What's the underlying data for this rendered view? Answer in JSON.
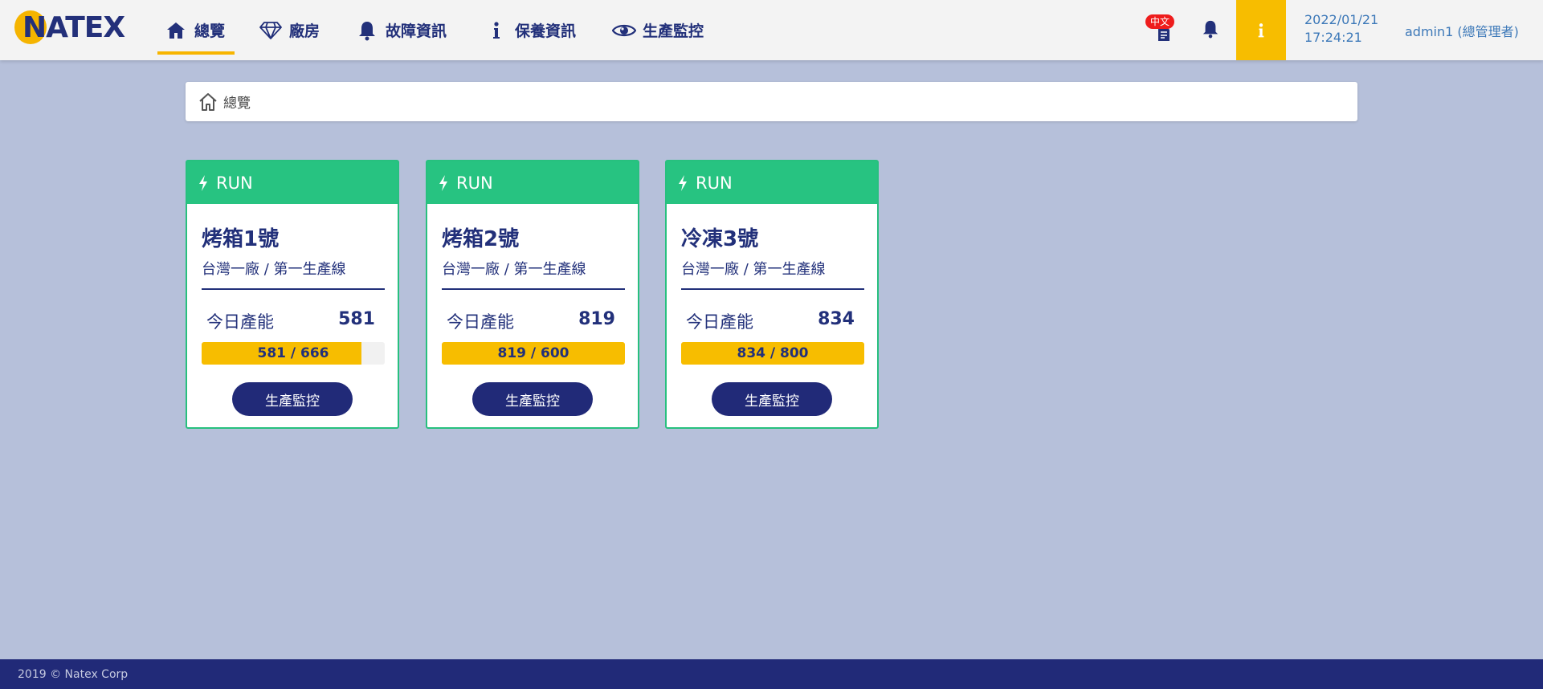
{
  "brand": {
    "logo_text": "NATEX"
  },
  "nav": {
    "items": [
      {
        "label": "總覽",
        "icon": "home-icon",
        "active": true
      },
      {
        "label": "廠房",
        "icon": "diamond-icon",
        "active": false
      },
      {
        "label": "故障資訊",
        "icon": "bell-icon",
        "active": false
      },
      {
        "label": "保養資訊",
        "icon": "info-icon",
        "active": false
      },
      {
        "label": "生產監控",
        "icon": "eye-icon",
        "active": false
      }
    ]
  },
  "header": {
    "language_badge": "中文",
    "date": "2022/01/21",
    "time": "17:24:21",
    "user": "admin1 (總管理者)"
  },
  "breadcrumb": {
    "current": "總覽"
  },
  "cards": [
    {
      "status": "RUN",
      "name": "烤箱1號",
      "location": "台灣一廠 / 第一生產線",
      "metric_label": "今日產能",
      "metric_value": "581",
      "progress_text": "581 / 666",
      "progress_fraction": 0.872,
      "button_label": "生產監控"
    },
    {
      "status": "RUN",
      "name": "烤箱2號",
      "location": "台灣一廠 / 第一生產線",
      "metric_label": "今日產能",
      "metric_value": "819",
      "progress_text": "819 / 600",
      "progress_fraction": 1.0,
      "button_label": "生產監控"
    },
    {
      "status": "RUN",
      "name": "冷凍3號",
      "location": "台灣一廠 / 第一生產線",
      "metric_label": "今日產能",
      "metric_value": "834",
      "progress_text": "834 / 800",
      "progress_fraction": 1.0,
      "button_label": "生產監控"
    }
  ],
  "footer": {
    "text": "2019 © Natex Corp"
  },
  "colors": {
    "navy": "#22307a",
    "accent_yellow": "#f7bd00",
    "run_green": "#27c381",
    "page_bg": "#b6c0da"
  }
}
